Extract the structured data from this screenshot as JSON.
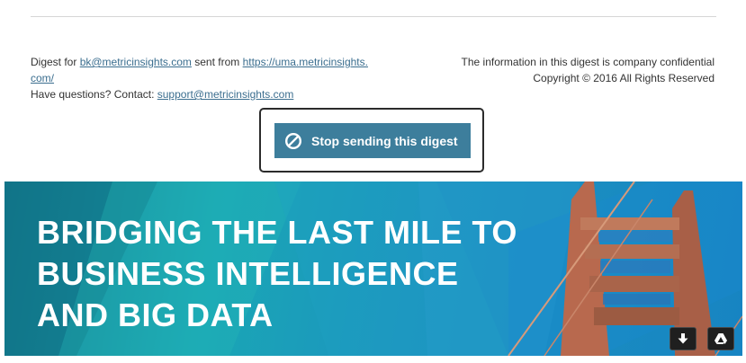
{
  "footer": {
    "digest_for_prefix": "Digest for ",
    "recipient_email": "bk@metricinsights.com",
    "sent_from_text": " sent from ",
    "sent_from_url_line1": "https://uma.metricinsights.",
    "sent_from_url_line2": "com/",
    "questions_text": "Have questions? Contact: ",
    "support_email": "support@metricinsights.com",
    "confidential_text": "The information in this digest is company confidential",
    "copyright_text": "Copyright © 2016 All Rights Reserved"
  },
  "stop_button": {
    "label": "Stop sending this digest",
    "icon": "prohibit-icon"
  },
  "banner": {
    "title_lines": [
      "BRIDGING THE LAST MILE TO",
      "BUSINESS INTELLIGENCE",
      "AND BIG DATA"
    ]
  },
  "overlay_buttons": {
    "download_icon": "download-arrow-icon",
    "drive_icon": "google-drive-icon"
  }
}
